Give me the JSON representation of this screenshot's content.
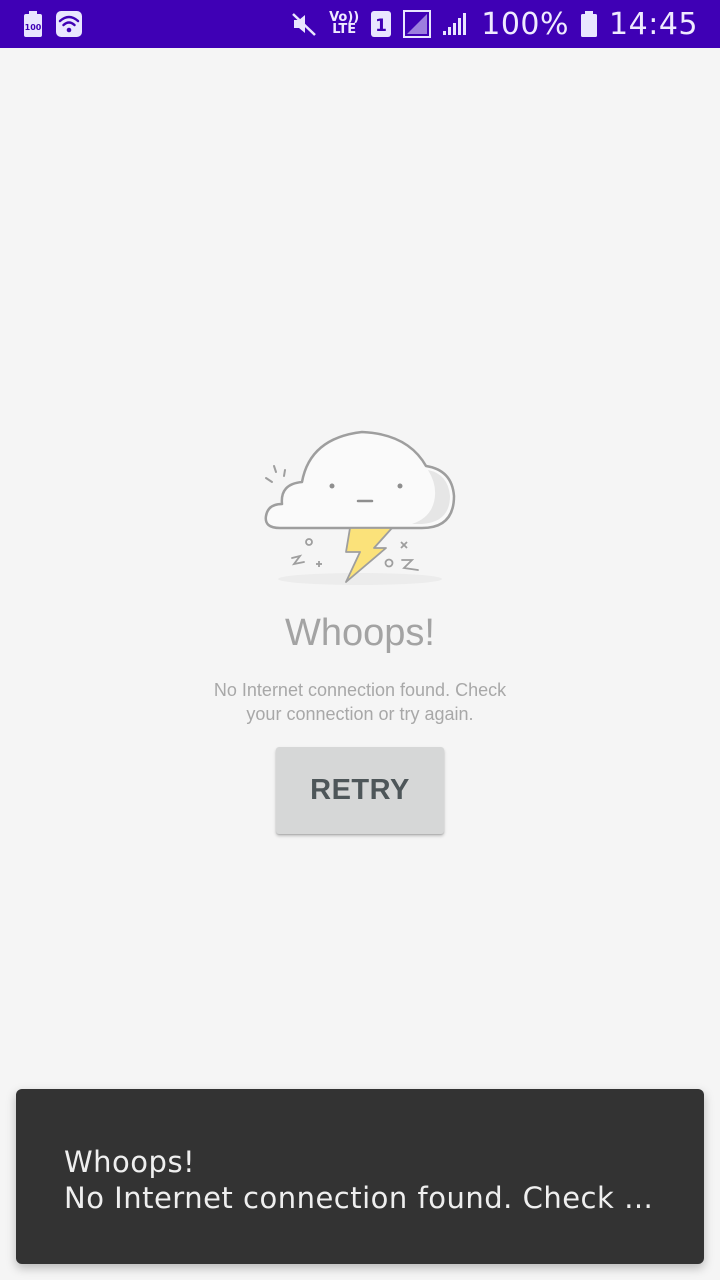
{
  "status_bar": {
    "battery_saver_label": "100",
    "volte_top": "Vo))",
    "volte_bottom": "LTE",
    "sim_label": "1",
    "battery_percent": "100%",
    "time": "14:45",
    "background_color": "#3f00b5"
  },
  "error_view": {
    "title": "Whoops!",
    "message_line1": "No Internet connection found. Check",
    "message_line2": "your connection or try again.",
    "retry_label": "RETRY",
    "illustration_icon": "cloud-lightning-icon"
  },
  "snackbar": {
    "title": "Whoops!",
    "message": "No Internet connection found. Check …"
  }
}
